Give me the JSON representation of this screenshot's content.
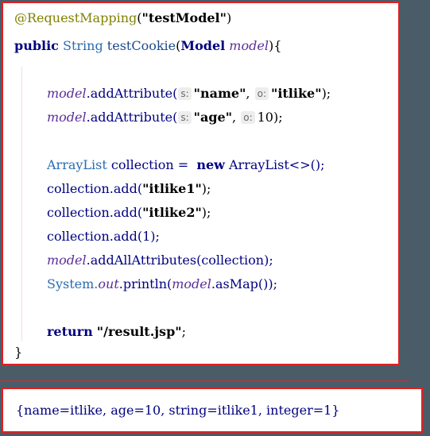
{
  "editor": {
    "annotation": {
      "at": "@RequestMapping",
      "open": "(",
      "arg": "\"testModel\"",
      "close": ")"
    },
    "signature": {
      "public": "public",
      "type": "String",
      "method": "testCookie",
      "open": "(",
      "ptype": "Model",
      "pname": "model",
      "close": ")",
      "brace": "{"
    },
    "line_attr1": {
      "var": "model",
      "call": ".addAttribute(",
      "hint1": "s:",
      "arg1": "\"name\"",
      "comma": ",",
      "hint2": "o:",
      "arg2": "\"itlike\"",
      "end": ");"
    },
    "line_attr2": {
      "var": "model",
      "call": ".addAttribute(",
      "hint1": "s:",
      "arg1": "\"age\"",
      "comma": ",",
      "hint2": "o:",
      "arg2": "10",
      "end": ");"
    },
    "line_list": {
      "type": "ArrayList",
      "rest": " collection =  ",
      "new": "new",
      "ctor": " ArrayList<>();"
    },
    "line_add1": {
      "text": "collection.add(",
      "arg": "\"itlike1\"",
      "end": ");"
    },
    "line_add2": {
      "text": "collection.add(",
      "arg": "\"itlike2\"",
      "end": ");"
    },
    "line_add3": {
      "text": "collection.add(1);"
    },
    "line_addall": {
      "var": "model",
      "rest": ".addAllAttributes(collection);"
    },
    "line_println": {
      "sys": "System.",
      "out": "out",
      "mid": ".println(",
      "var": "model",
      "end": ".asMap());"
    },
    "line_return": {
      "kw": "return",
      "arg": "\"/result.jsp\"",
      "end": ";"
    },
    "closing_brace": "}"
  },
  "console": {
    "output": "{name=itlike, age=10, string=itlike1, integer=1}"
  },
  "colors": {
    "background": "#4b5c69",
    "border": "#e02020",
    "keyword": "#000080",
    "annotation": "#808000",
    "field": "#5a2e9a"
  }
}
